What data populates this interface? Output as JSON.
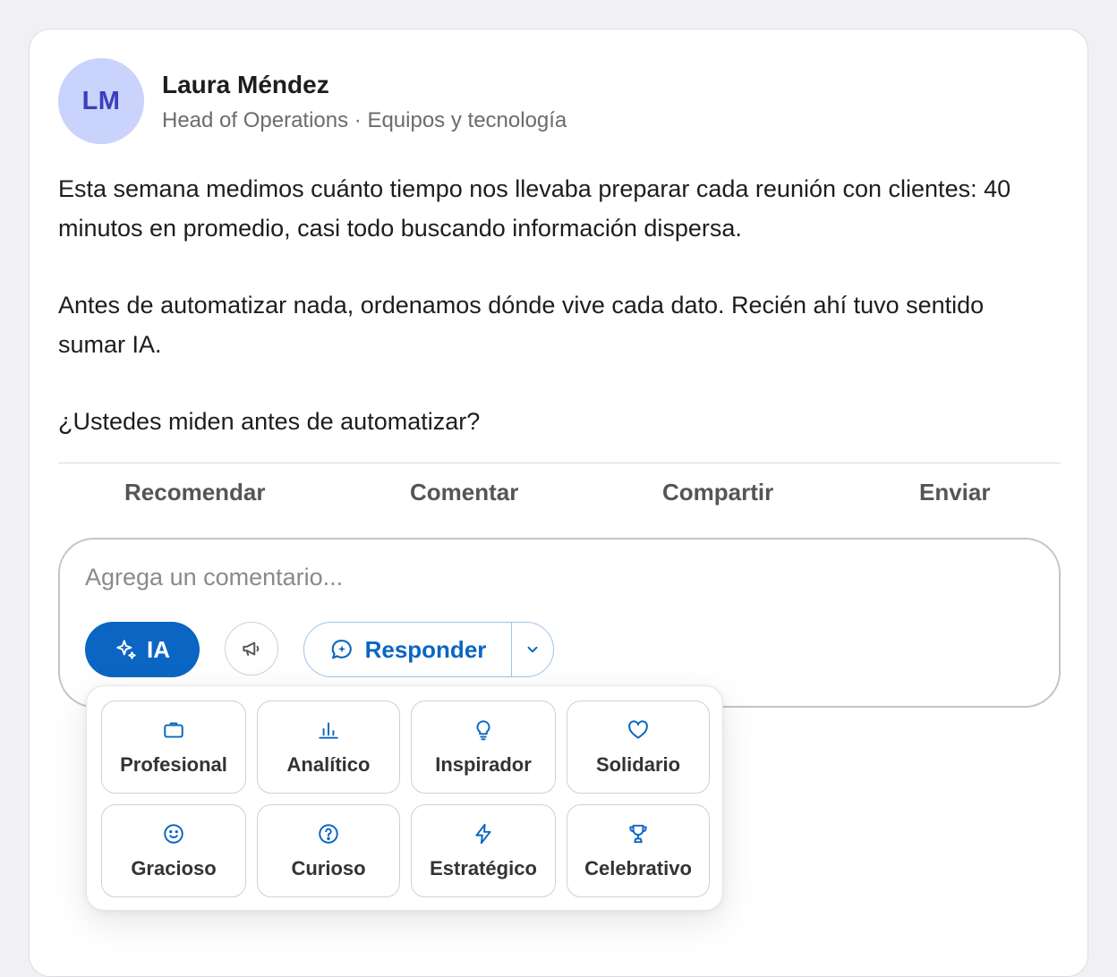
{
  "post": {
    "author": {
      "initials": "LM",
      "name": "Laura Méndez",
      "meta": "Head of Operations · Equipos y tecnología"
    },
    "paragraphs": [
      "Esta semana medimos cuánto tiempo nos llevaba preparar cada reunión con clientes: 40 minutos en promedio, casi todo buscando información dispersa.",
      "Antes de automatizar nada, ordenamos dónde vive cada dato. Recién ahí tuvo sentido sumar IA.",
      "¿Ustedes miden antes de automatizar?"
    ]
  },
  "actions": {
    "recommend": "Recomendar",
    "comment": "Comentar",
    "share": "Compartir",
    "send": "Enviar"
  },
  "composer": {
    "placeholder": "Agrega un comentario...",
    "ia_label": "IA",
    "responder_label": "Responder"
  },
  "tones": [
    {
      "label": "Profesional",
      "icon": "briefcase-icon"
    },
    {
      "label": "Analítico",
      "icon": "bar-chart-icon"
    },
    {
      "label": "Inspirador",
      "icon": "lightbulb-icon"
    },
    {
      "label": "Solidario",
      "icon": "heart-icon"
    },
    {
      "label": "Gracioso",
      "icon": "smiley-icon"
    },
    {
      "label": "Curioso",
      "icon": "question-icon"
    },
    {
      "label": "Estratégico",
      "icon": "lightning-icon"
    },
    {
      "label": "Celebrativo",
      "icon": "trophy-icon"
    }
  ],
  "colors": {
    "accent": "#0a66c2",
    "avatar_bg": "#c9d3fb",
    "avatar_text": "#3a3fbd"
  }
}
